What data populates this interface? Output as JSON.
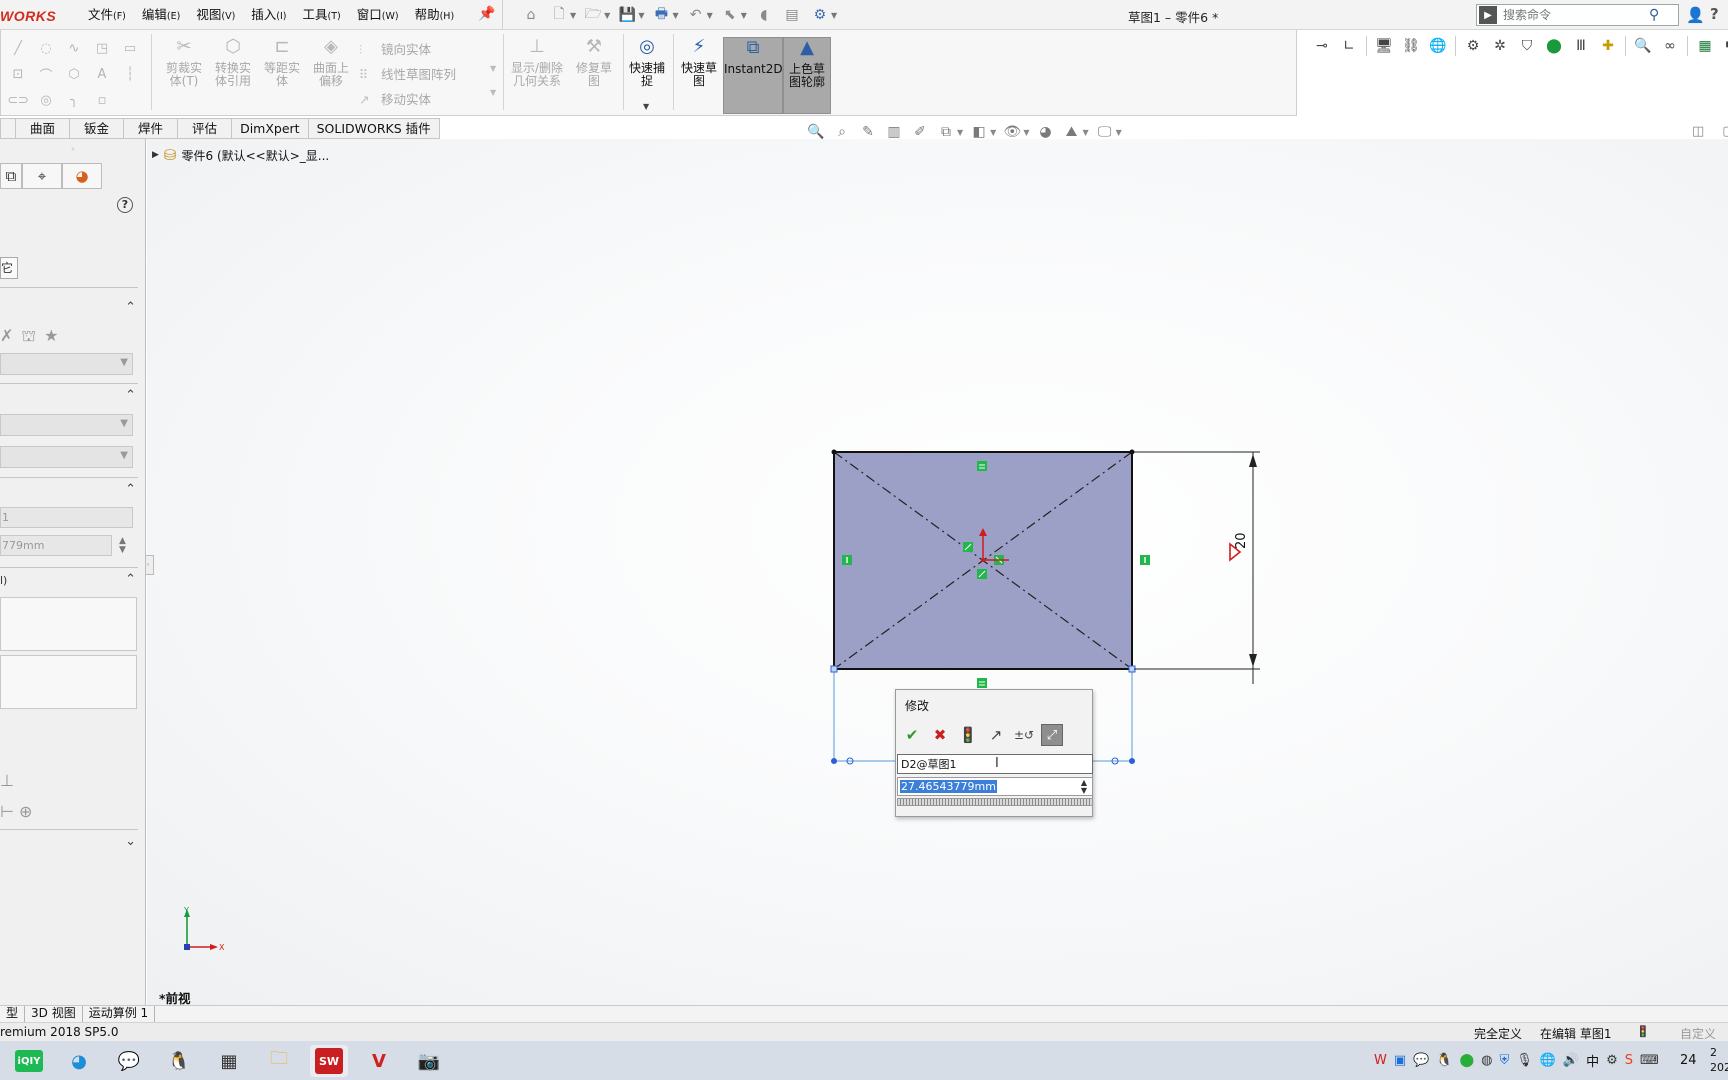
{
  "app": {
    "brand": "WORKS",
    "document_title": "草图1 – 零件6 *"
  },
  "menu": [
    {
      "label": "文件",
      "key": "(F)"
    },
    {
      "label": "编辑",
      "key": "(E)"
    },
    {
      "label": "视图",
      "key": "(V)"
    },
    {
      "label": "插入",
      "key": "(I)"
    },
    {
      "label": "工具",
      "key": "(T)"
    },
    {
      "label": "窗口",
      "key": "(W)"
    },
    {
      "label": "帮助",
      "key": "(H)"
    }
  ],
  "search": {
    "placeholder": "搜索命令"
  },
  "ribbon": {
    "trim_entities": "剪裁实\n体(T)",
    "convert_entities": "转换实\n体引用",
    "offset_entities": "等距实\n体",
    "offset_on_surface": "曲面上\n偏移",
    "mirror_entities": "镜向实体",
    "linear_pattern": "线性草图阵列",
    "move_entities": "移动实体",
    "display_relations": "显示/删除\n几何关系",
    "repair_sketch": "修复草\n图",
    "quick_snaps": "快速捕\n捉",
    "rapid_sketch": "快速草\n图",
    "instant2d": "Instant2D",
    "shaded_contours": "上色草\n图轮廓"
  },
  "tabs": [
    "曲面",
    "钣金",
    "焊件",
    "评估",
    "DimXpert",
    "SOLIDWORKS 插件"
  ],
  "property_manager": {
    "other_tab": "它",
    "field_name": "1",
    "field_value": "779mm",
    "section4_label": "l)"
  },
  "feature_tree": {
    "root_label": "零件6 (默认<<默认>_显..."
  },
  "sketch": {
    "dimension_value": "20"
  },
  "modify_dialog": {
    "title": "修改",
    "name": "D2@草图1",
    "value": "27.46543779mm"
  },
  "triad": {
    "x_label": "X",
    "y_label": "Y"
  },
  "view_label": "*前视",
  "bottom_tabs": [
    "型",
    "3D 视图",
    "运动算例 1"
  ],
  "status": {
    "product": "remium 2018 SP5.0",
    "defined": "完全定义",
    "editing": "在编辑 草图1",
    "custom": "自定义"
  },
  "taskbar": {
    "iqiyi_label": "iQIY",
    "sw_label": "SW",
    "ime": "中",
    "time": "24",
    "date_top": "2",
    "date_bottom": "202"
  },
  "colors": {
    "sketch_fill": "#9da0c6",
    "relation_green": "#21b74a",
    "dimension_red": "#d11c1c",
    "selection_blue": "#3b7fd9"
  }
}
